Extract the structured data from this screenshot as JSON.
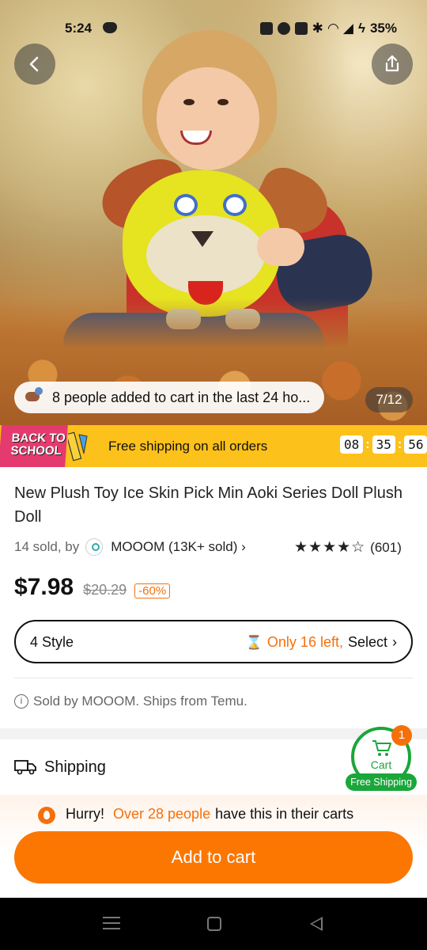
{
  "status_bar": {
    "time": "5:24",
    "battery": "35%",
    "icons": [
      "discord-icon",
      "nfc-icon",
      "alarm-icon",
      "vibrate-icon",
      "bluetooth-icon",
      "wifi-icon",
      "signal-icon",
      "battery-charging-icon"
    ]
  },
  "hero": {
    "added_to_cart_text": "8 people added to cart in the last 24 ho...",
    "image_counter": "7/12"
  },
  "promo": {
    "badge_line1": "BACK TO",
    "badge_line2": "SCHOOL",
    "text": "Free shipping on all orders",
    "timer": {
      "hours": "08",
      "minutes": "35",
      "seconds": "56"
    }
  },
  "product": {
    "title": "New Plush Toy Ice Skin Pick Min Aoki Series Doll Plush Doll",
    "sold_text": "14 sold, by",
    "store": "MOOOM (13K+ sold)",
    "stars": "★★★★☆",
    "rating_count": "(601)",
    "price": "$7.98",
    "old_price": "$20.29",
    "discount": "-60%",
    "style_label": "4 Style",
    "stock_text": "Only 16 left,",
    "select_text": "Select",
    "sold_by_text": "Sold by MOOOM. Ships from Temu."
  },
  "shipping": {
    "label": "Shipping"
  },
  "float_cart": {
    "label": "Cart",
    "badge": "1",
    "free_shipping": "Free Shipping"
  },
  "bottom": {
    "hurry": "Hurry!",
    "hurry_highlight": "Over 28 people",
    "hurry_rest": "have this in their carts",
    "add_to_cart": "Add to cart"
  },
  "colors": {
    "accent_orange": "#fb7701",
    "promo_yellow": "#fcc11b",
    "free_ship_green": "#1aa63a"
  }
}
